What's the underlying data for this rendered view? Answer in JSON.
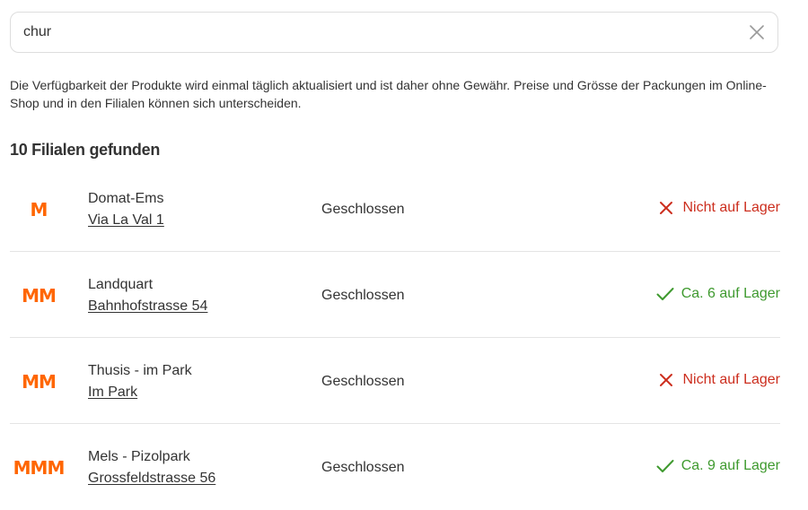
{
  "search": {
    "value": "chur",
    "placeholder": ""
  },
  "disclaimer": "Die Verfügbarkeit der Produkte wird einmal täglich aktualisiert und ist daher ohne Gewähr. Preise und Grösse der Packungen im Online-Shop und in den Filialen können sich unterscheiden.",
  "results": {
    "heading": "10 Filialen gefunden"
  },
  "colors": {
    "brand": "#ff6600",
    "out_of_stock": "#cc2e1e",
    "in_stock": "#3f9a2f",
    "divider": "#e4e4e4"
  },
  "stores": [
    {
      "logo": "M",
      "name": "Domat-Ems",
      "address": "Via La Val 1",
      "hours": "Geschlossen",
      "stock_icon": "cross-icon",
      "stock": "Nicht auf Lager",
      "in_stock": false
    },
    {
      "logo": "MM",
      "name": "Landquart",
      "address": "Bahnhofstrasse 54",
      "hours": "Geschlossen",
      "stock_icon": "check-icon",
      "stock": "Ca. 6 auf Lager",
      "in_stock": true
    },
    {
      "logo": "MM",
      "name": "Thusis - im Park",
      "address": "Im Park",
      "hours": "Geschlossen",
      "stock_icon": "cross-icon",
      "stock": "Nicht auf Lager",
      "in_stock": false
    },
    {
      "logo": "MMM",
      "name": "Mels - Pizolpark",
      "address": "Grossfeldstrasse 56",
      "hours": "Geschlossen",
      "stock_icon": "check-icon",
      "stock": "Ca. 9 auf Lager",
      "in_stock": true
    }
  ]
}
